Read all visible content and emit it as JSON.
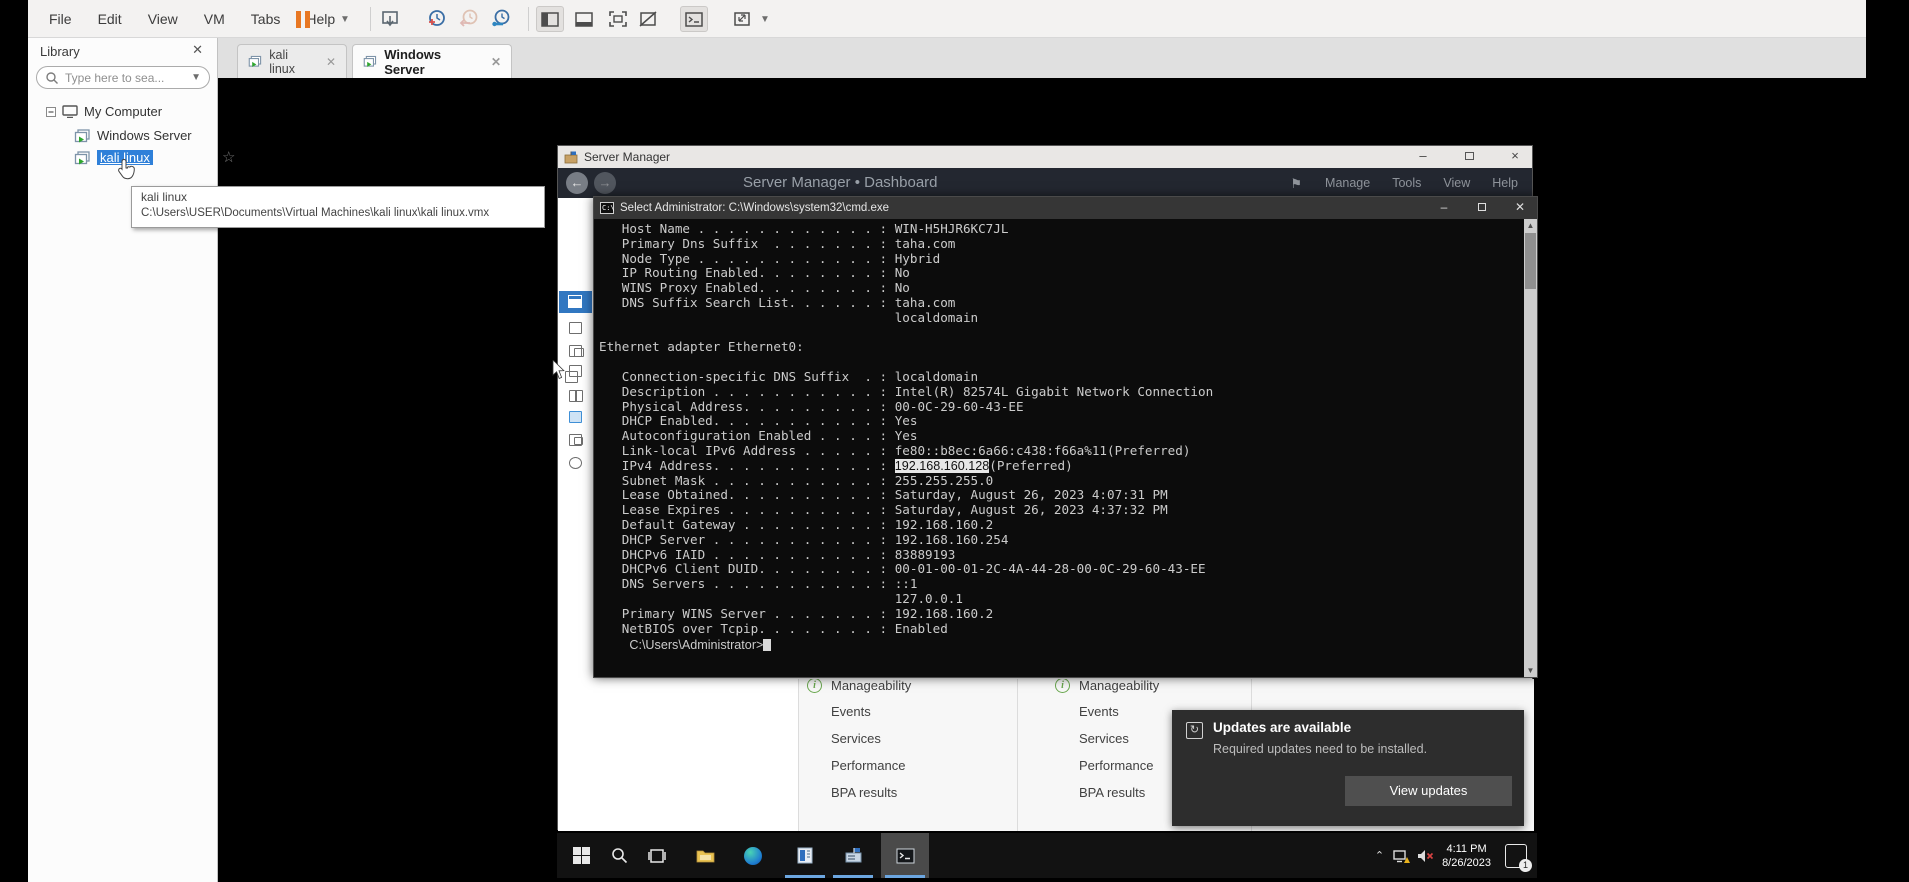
{
  "colors": {
    "accent_blue": "#2f80d9",
    "tab_open_indicator": "#6ca6e0",
    "status_green": "#6aa84f",
    "pause_orange": "#e87722",
    "console_bg": "#0c0c0c",
    "console_text": "#cccccc"
  },
  "menubar": {
    "items": [
      "File",
      "Edit",
      "View",
      "VM",
      "Tabs",
      "Help"
    ]
  },
  "toolbar": {
    "icons": [
      "pause",
      "send-ctrl-alt-del",
      "take-snapshot",
      "revert-snapshot",
      "manage-snapshots",
      "show-library",
      "show-thumbnail-bar",
      "enter-fullscreen",
      "unity-mode",
      "console-view",
      "stretch-view"
    ]
  },
  "library": {
    "title": "Library",
    "search_placeholder": "Type here to sea...",
    "tree": {
      "root": "My Computer",
      "items": [
        {
          "label": "Windows Server"
        },
        {
          "label": "kali linux",
          "selected": true
        }
      ]
    }
  },
  "tooltip": {
    "name": "kali linux",
    "path": "C:\\Users\\USER\\Documents\\Virtual Machines\\kali linux\\kali linux.vmx"
  },
  "tabs": [
    {
      "label": "kali linux",
      "active": false
    },
    {
      "label": "Windows Server",
      "active": true
    }
  ],
  "server_manager": {
    "title": "Server Manager",
    "breadcrumb": "Server Manager • Dashboard",
    "menu": [
      "Manage",
      "Tools",
      "View",
      "Help"
    ],
    "window_buttons": {
      "minimize": "–",
      "close": "×"
    }
  },
  "cmd": {
    "title": "Select Administrator: C:\\Windows\\system32\\cmd.exe",
    "highlight": "192.168.160.128",
    "lines": [
      "   Host Name . . . . . . . . . . . . : WIN-H5HJR6KC7JL",
      "   Primary Dns Suffix  . . . . . . . : taha.com",
      "   Node Type . . . . . . . . . . . . : Hybrid",
      "   IP Routing Enabled. . . . . . . . : No",
      "   WINS Proxy Enabled. . . . . . . . : No",
      "   DNS Suffix Search List. . . . . . : taha.com",
      "                                       localdomain",
      "",
      "Ethernet adapter Ethernet0:",
      "",
      "   Connection-specific DNS Suffix  . : localdomain",
      "   Description . . . . . . . . . . . : Intel(R) 82574L Gigabit Network Connection",
      "   Physical Address. . . . . . . . . : 00-0C-29-60-43-EE",
      "   DHCP Enabled. . . . . . . . . . . : Yes",
      "   Autoconfiguration Enabled . . . . : Yes",
      "   Link-local IPv6 Address . . . . . : fe80::b8ec:6a66:c438:f66a%11(Preferred)",
      "   IPv4 Address. . . . . . . . . . . : 192.168.160.128(Preferred)",
      "   Subnet Mask . . . . . . . . . . . : 255.255.255.0",
      "   Lease Obtained. . . . . . . . . . : Saturday, August 26, 2023 4:07:31 PM",
      "   Lease Expires . . . . . . . . . . : Saturday, August 26, 2023 4:37:32 PM",
      "   Default Gateway . . . . . . . . . : 192.168.160.2",
      "   DHCP Server . . . . . . . . . . . : 192.168.160.254",
      "   DHCPv6 IAID . . . . . . . . . . . : 83889193",
      "   DHCPv6 Client DUID. . . . . . . . : 00-01-00-01-2C-4A-44-28-00-0C-29-60-43-EE",
      "   DNS Servers . . . . . . . . . . . : ::1",
      "                                       127.0.0.1",
      "   Primary WINS Server . . . . . . . : 192.168.160.2",
      "   NetBIOS over Tcpip. . . . . . . . : Enabled",
      ""
    ],
    "prompt": "C:\\Users\\Administrator>"
  },
  "dashboard": {
    "rows": [
      "Manageability",
      "Events",
      "Services",
      "Performance",
      "BPA results"
    ]
  },
  "toast": {
    "title": "Updates are available",
    "message": "Required updates need to be installed.",
    "button": "View updates"
  },
  "taskbar": {
    "icons": [
      "start",
      "search",
      "task-view",
      "file-explorer",
      "edge",
      "app-window",
      "server-manager",
      "command-prompt"
    ],
    "time": "4:11 PM",
    "date": "8/26/2023",
    "notification_count": "1"
  }
}
